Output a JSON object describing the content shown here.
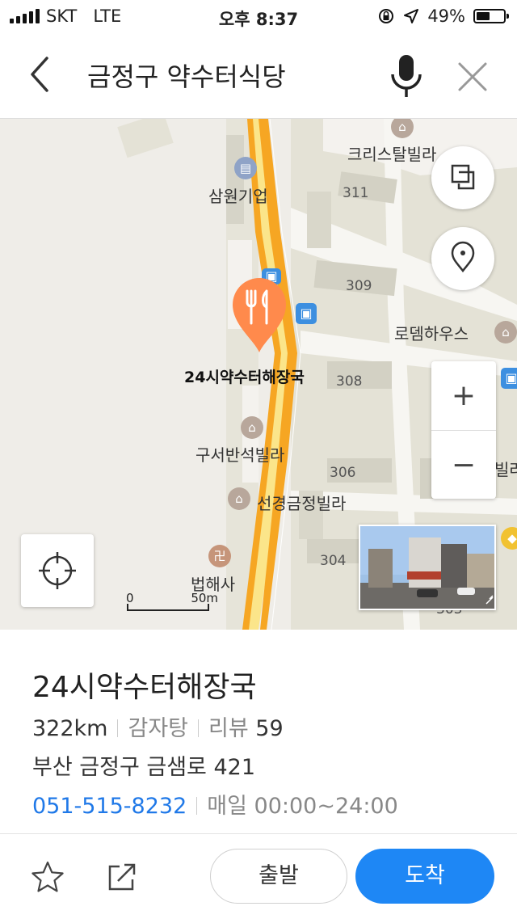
{
  "status_bar": {
    "carrier": "SKT",
    "network": "LTE",
    "time": "오후 8:37",
    "battery": "49%",
    "battery_level": 0.49
  },
  "search": {
    "query": "금정구 약수터식당"
  },
  "map": {
    "labels": {
      "samwon": "삼원기업",
      "crystal": "크리스탈빌라",
      "rodem": "로뎀하우스",
      "place_label": "24시약수터해장국",
      "guseo": "구서반석빌라",
      "seongyeong": "선경금정빌라",
      "beophaesa": "법해사",
      "partial_right": "빌라"
    },
    "building_numbers": [
      "311",
      "309",
      "308",
      "306",
      "304",
      "303"
    ],
    "scale": {
      "zero": "0",
      "distance": "50m"
    },
    "zoom_in": "+",
    "zoom_out": "−"
  },
  "place": {
    "name": "24시약수터해장국",
    "distance": "322km",
    "category": "감자탕",
    "review_label": "리뷰",
    "review_count": "59",
    "address": "부산 금정구 금샘로 421",
    "phone": "051-515-8232",
    "hours": "매일 00:00~24:00"
  },
  "actions": {
    "depart": "출발",
    "arrive": "도착"
  },
  "colors": {
    "accent": "#1e87f5",
    "phone_link": "#2079e8",
    "pin": "#ff8a4c",
    "road": "#f6a623"
  }
}
